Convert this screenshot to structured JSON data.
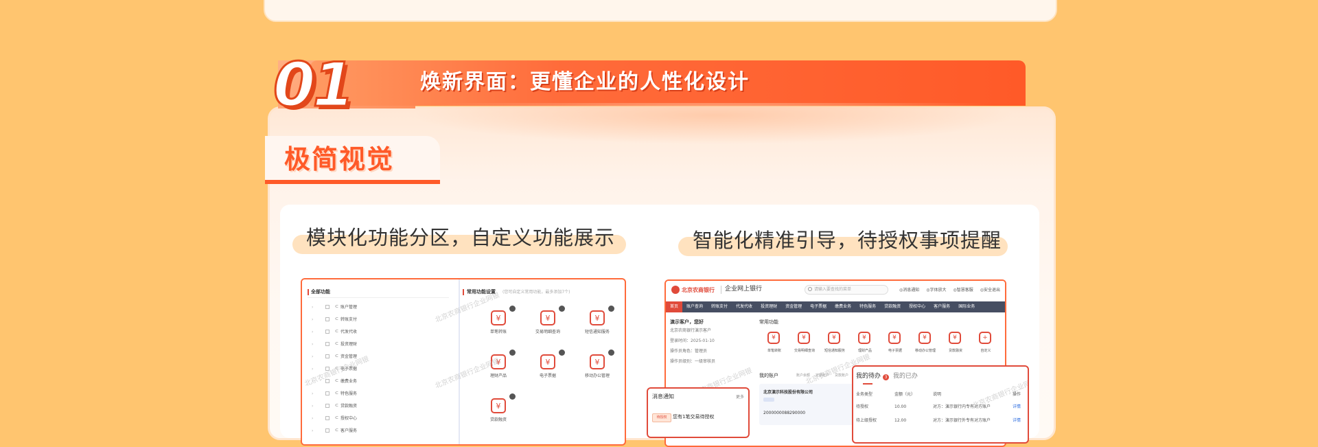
{
  "section": {
    "number": "01",
    "title": "焕新界面：更懂企业的人性化设计",
    "tab_title": "极简视觉"
  },
  "left": {
    "subtitle": "模块化功能分区，自定义功能展示",
    "all_label": "全部功能",
    "tree": [
      "账户管理",
      "转账支付",
      "代发代收",
      "投资理财",
      "资金管理",
      "电子票据",
      "缴费业务",
      "特色服务",
      "贷款融资",
      "授权中心",
      "客户服务"
    ],
    "common_label": "常用功能设置",
    "common_hint": "(您可自定义常用功能，最多添加7个)",
    "functions": [
      "单笔转账",
      "交易明细查询",
      "短信通知服务",
      "理财产品",
      "电子票据",
      "移动办公管理",
      "贷款融资"
    ]
  },
  "right": {
    "subtitle": "智能化精准引导，待授权事项提醒",
    "bank": "北京农商银行",
    "portal": "企业网上银行",
    "search_placeholder": "请输入要查找的菜单",
    "top_links": [
      "消息通知",
      "字体放大",
      "智慧客服",
      "安全退出"
    ],
    "nav": [
      "首页",
      "账户查询",
      "转账支付",
      "代发代收",
      "投资理财",
      "资金管理",
      "电子票据",
      "缴费业务",
      "特色服务",
      "贷款融资",
      "授权中心",
      "客户服务",
      "国际业务"
    ],
    "greeting": "演示客户，您好",
    "company_info": [
      "北京农商银行演示客户",
      "登录时间：2025-01-10",
      "操作员角色：管理员",
      "操作员级别：一级审核员"
    ],
    "common_label": "常用功能",
    "functions": [
      "单笔转账",
      "交易明细查询",
      "短信通知服务",
      "理财产品",
      "电子票据",
      "移动办公管理",
      "贷款融资",
      "自定义"
    ],
    "my_accounts": "我的账户",
    "account_tabs": [
      "账户余额",
      "定期账户",
      "贷款账户"
    ],
    "account_company": "北京演示科技股份有限公司",
    "account_no": "2000000088290000",
    "pending_tab": "我的待办",
    "done_tab": "我的已办",
    "pending_count": "3",
    "pending_headers": [
      "业务类型",
      "金额（元）",
      "说明",
      "操作"
    ],
    "pending_rows": [
      [
        "待授权",
        "10.00",
        "对方：演示银行内专有对方账户",
        "详情"
      ],
      [
        "待上级授权",
        "12.00",
        "对方：演示银行外专有对方账户",
        "详情"
      ]
    ],
    "message_label": "消息通知",
    "message_more": "更多",
    "message_tag": "待授权",
    "message_text": "您有1笔交易待授权"
  },
  "watermark": "北京农商银行企业网银",
  "colors": {
    "accent": "#ff5a28",
    "background": "#ffc56f",
    "nav": "#e04a3a"
  },
  "icons": {
    "function": "function-icon",
    "bank_logo": "bank-logo-icon",
    "search": "search-icon"
  }
}
